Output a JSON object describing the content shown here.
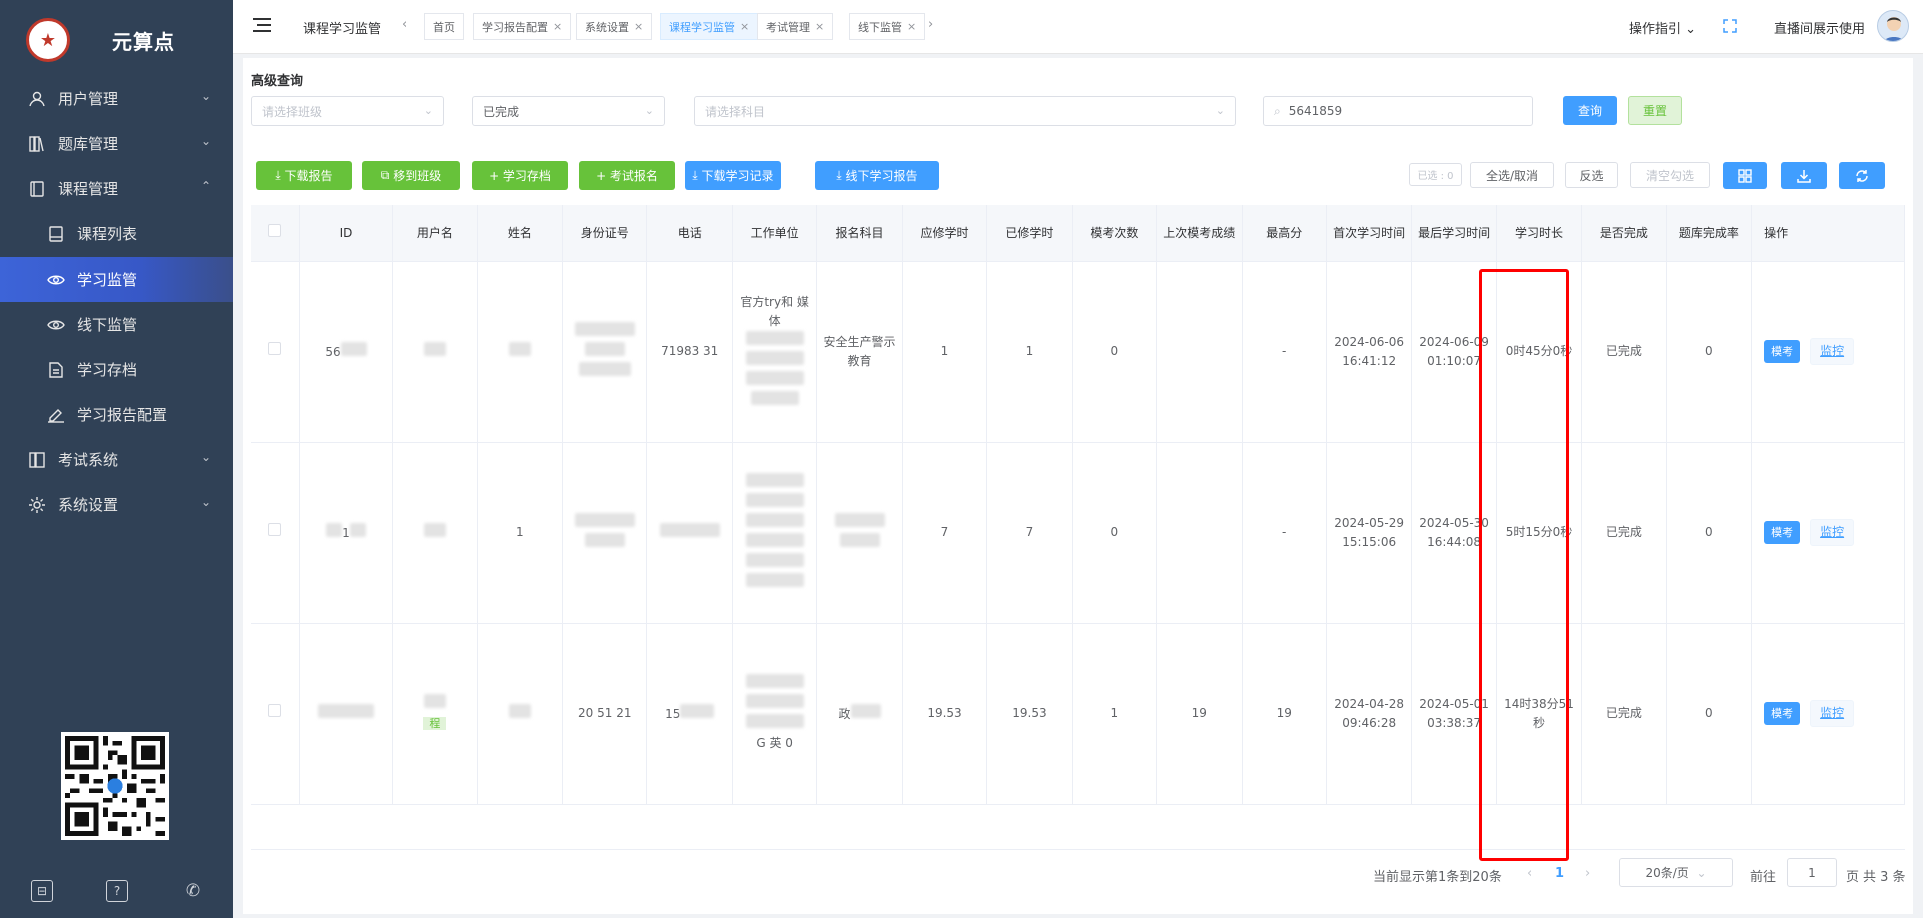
{
  "brand": {
    "name": "元算点"
  },
  "sidebar": {
    "items": [
      {
        "label": "用户管理",
        "icon": "users-icon",
        "expanded": false
      },
      {
        "label": "题库管理",
        "icon": "books-icon",
        "expanded": false
      },
      {
        "label": "课程管理",
        "icon": "book-icon",
        "expanded": true
      },
      {
        "label": "课程列表",
        "icon": "book-page-icon"
      },
      {
        "label": "学习监管",
        "icon": "eye-icon",
        "active": true
      },
      {
        "label": "线下监管",
        "icon": "eye-icon"
      },
      {
        "label": "学习存档",
        "icon": "document-icon"
      },
      {
        "label": "学习报告配置",
        "icon": "pen-icon"
      },
      {
        "label": "考试系统",
        "icon": "exam-icon",
        "expanded": false
      },
      {
        "label": "系统设置",
        "icon": "gear-icon",
        "expanded": false
      }
    ]
  },
  "header": {
    "title": "课程学习监管",
    "tabs": [
      {
        "label": "首页",
        "closable": false
      },
      {
        "label": "学习报告配置",
        "closable": true
      },
      {
        "label": "系统设置",
        "closable": true
      },
      {
        "label": "课程学习监管",
        "closable": true,
        "active": true
      },
      {
        "label": "考试管理",
        "closable": true
      },
      {
        "label": "线下监管",
        "closable": true
      }
    ],
    "guide": "操作指引",
    "usage": "直播间展示使用"
  },
  "filters": {
    "section_title": "高级查询",
    "class_placeholder": "请选择班级",
    "status_value": "已完成",
    "subject_placeholder": "请选择科目",
    "search_value": "5641859",
    "query_label": "查询",
    "reset_label": "重置"
  },
  "toolbar": {
    "download_report": "下载报告",
    "move_class": "移到班级",
    "study_archive": "+ 学习存档",
    "exam_signup": "+ 考试报名",
    "download_records": "下载学习记录",
    "offline_report": "线下学习报告",
    "selected": "已选 : 0",
    "select_all": "全选/取消",
    "invert": "反选",
    "clear": "清空勾选"
  },
  "table": {
    "headers": [
      "",
      "ID",
      "用户名",
      "姓名",
      "身份证号",
      "电话",
      "工作单位",
      "报名科目",
      "应修学时",
      "已修学时",
      "模考次数",
      "上次模考成绩",
      "最高分",
      "首次学习时间",
      "最后学习时间",
      "学习时长",
      "是否完成",
      "题库完成率",
      "操作"
    ],
    "rows": [
      {
        "id": "56",
        "phone": "71983 31",
        "work": "官方try和 媒体",
        "subject": "安全生产警示教育",
        "req": "1",
        "done": "1",
        "count": "0",
        "last": "",
        "max": "-",
        "first": "2024-06-06 16:41:12",
        "lastTime": "2024-06-09 01:10:07",
        "duration": "0时45分0秒",
        "finished": "已完成",
        "rate": "0"
      },
      {
        "id": "1",
        "name": "1",
        "phone": "",
        "work": "",
        "subject": "",
        "req": "7",
        "done": "7",
        "count": "0",
        "last": "",
        "max": "-",
        "first": "2024-05-29 15:15:06",
        "lastTime": "2024-05-30 16:44:08",
        "duration": "5时15分0秒",
        "finished": "已完成",
        "rate": "0"
      },
      {
        "id": "",
        "tag": "程",
        "idcard": "20 51 21",
        "phone": "15",
        "work": "G 英 0",
        "subject": "政",
        "req": "19.53",
        "done": "19.53",
        "count": "1",
        "last": "19",
        "max": "19",
        "first": "2024-04-28 09:46:28",
        "lastTime": "2024-05-01 03:38:37",
        "duration": "14时38分51秒",
        "finished": "已完成",
        "rate": "0"
      }
    ],
    "op_exam": "模考",
    "op_monitor": "监控"
  },
  "pagination": {
    "summary": "当前显示第1条到20条",
    "current": "1",
    "page_size": "20条/页",
    "goto_label": "前往",
    "goto_value": "1",
    "page_unit": "页",
    "total": "共 3 条"
  },
  "colors": {
    "sidebar": "#304156",
    "primary": "#409eff",
    "success": "#67c23a",
    "highlight": "#ff0000"
  }
}
